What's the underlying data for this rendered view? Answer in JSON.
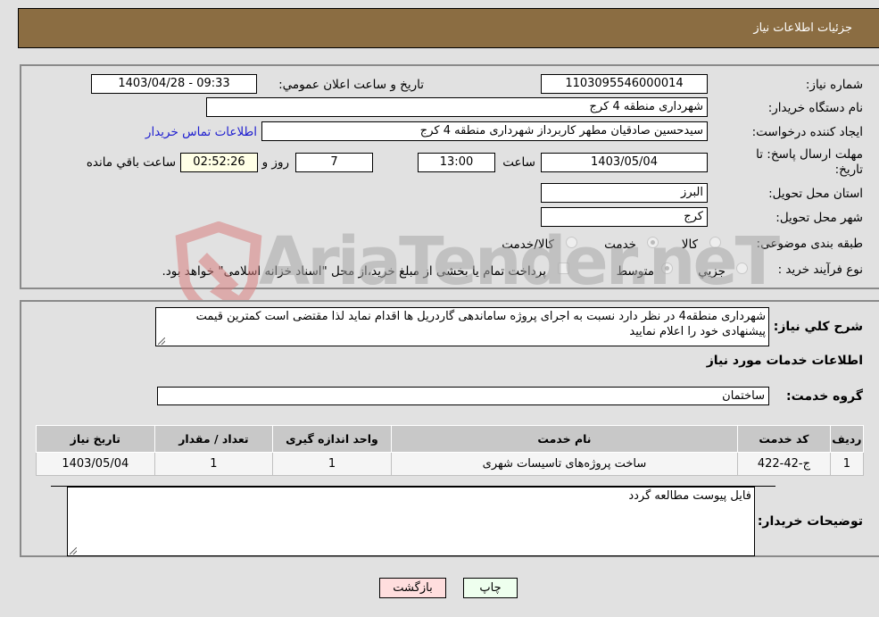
{
  "header": {
    "title": "جزئیات اطلاعات نیاز"
  },
  "details": {
    "need_number_label": "شماره نیاز:",
    "need_number": "1103095546000014",
    "announce_label": "تاریخ و ساعت اعلان عمومي:",
    "announce_value": "1403/04/28 - 09:33",
    "buyer_org_label": "نام دستگاه خریدار:",
    "buyer_org": "شهرداری منطقه 4 کرج",
    "creator_label": "ایجاد کننده درخواست:",
    "creator": "سیدحسین صادقیان مطهر کاربرداز شهرداری منطقه 4 کرج",
    "contact_link": "اطلاعات تماس خریدار",
    "deadline_label": "مهلت ارسال پاسخ: تا تاریخ:",
    "deadline_date": "1403/05/04",
    "time_label": "ساعت",
    "deadline_time": "13:00",
    "days_remaining": "7",
    "days_label": "روز و",
    "time_remaining": "02:52:26",
    "remaining_label": "ساعت باقي مانده",
    "province_label": "استان محل تحویل:",
    "province": "البرز",
    "city_label": "شهر محل تحویل:",
    "city": "کرج",
    "category_label": "طبقه بندی موضوعی:",
    "category_options": [
      {
        "label": "کالا",
        "checked": false
      },
      {
        "label": "خدمت",
        "checked": true
      },
      {
        "label": "کالا/خدمت",
        "checked": false
      }
    ],
    "process_label": "نوع فرآیند خرید :",
    "process_options": [
      {
        "label": "جزيي",
        "checked": false
      },
      {
        "label": "متوسط",
        "checked": true
      }
    ],
    "treasury_note": "پرداخت تمام یا بخشی از مبلغ خرید،از محل \"اسناد خزانه اسلامی\" خواهد بود.",
    "treasury_checked": false
  },
  "description": {
    "label": "شرح کلي نیاز:",
    "text": "شهرداری منطقه4 در نظر دارد نسبت به اجرای پروژه ساماندهی گاردریل ها اقدام نماید لذا مقتضی است کمترین قیمت پیشنهادی خود را اعلام نمایید"
  },
  "services": {
    "section_title": "اطلاعات خدمات مورد نیاز",
    "group_label": "گروه خدمت:",
    "group_value": "ساختمان",
    "table": {
      "headers": [
        "ردیف",
        "کد خدمت",
        "نام خدمت",
        "واحد اندازه گیری",
        "تعداد / مقدار",
        "تاریخ نیاز"
      ],
      "rows": [
        [
          "1",
          "ج-42-422",
          "ساخت پروژه‌های تاسیسات شهری",
          "1",
          "1",
          "1403/05/04"
        ]
      ]
    }
  },
  "buyer_notes": {
    "label": "توضیحات خریدار:",
    "text": "فایل پیوست مطالعه گردد"
  },
  "buttons": {
    "print": "چاپ",
    "back": "بازگشت"
  },
  "watermark": {
    "text": "AriaTender.neT"
  },
  "colors": {
    "header_bg": "#8b6d42",
    "link": "#2020d0",
    "print_bg": "#eeffee",
    "back_bg": "#ffdede",
    "remaining_bg": "#ffffe6"
  }
}
